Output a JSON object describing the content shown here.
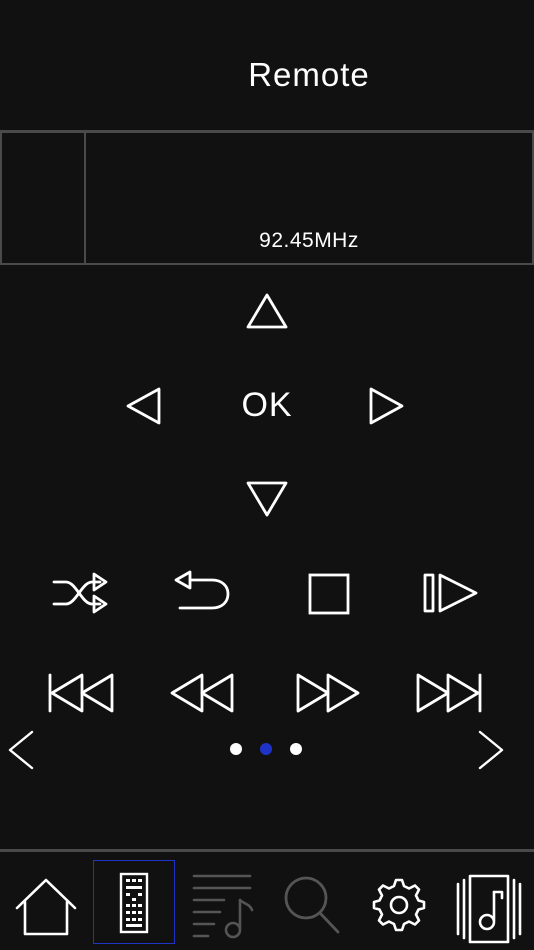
{
  "header": {
    "title": "Remote"
  },
  "info_panel": {
    "frequency": "92.45MHz"
  },
  "dpad": {
    "ok_label": "OK"
  },
  "pager": {
    "page_count": 3,
    "current_page": 2,
    "active_color": "#1f33c8",
    "inactive_color": "#ffffff"
  },
  "tabbar": {
    "active_tab": "remote",
    "active_border_color": "#1f33c8",
    "tabs": [
      {
        "id": "home",
        "icon": "home-icon"
      },
      {
        "id": "remote",
        "icon": "remote-control-icon"
      },
      {
        "id": "playlist",
        "icon": "playlist-icon"
      },
      {
        "id": "search",
        "icon": "search-icon"
      },
      {
        "id": "settings",
        "icon": "gear-icon"
      },
      {
        "id": "library",
        "icon": "music-library-icon"
      }
    ]
  },
  "colors": {
    "background": "#111111",
    "divider": "#4a4a4a",
    "foreground": "#ffffff",
    "accent": "#1f33c8",
    "tab_inactive": "#555555"
  }
}
